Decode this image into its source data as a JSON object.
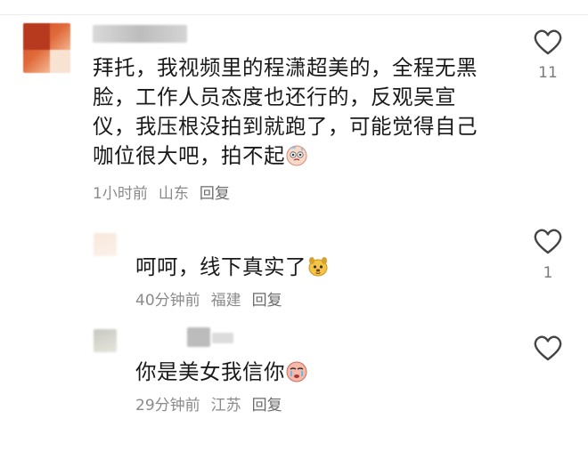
{
  "comments": [
    {
      "text": "拜托，我视频里的程潇超美的，全程无黑脸，工作人员态度也还行的，反观吴宣仪，我压根没拍到就跑了，可能觉得自己咖位很大吧，拍不起",
      "time": "1小时前",
      "location": "山东",
      "reply": "回复",
      "likes": "11"
    }
  ],
  "replies": [
    {
      "text": "呵呵，线下真实了",
      "time": "40分钟前",
      "location": "福建",
      "reply": "回复",
      "likes": "1"
    },
    {
      "text": "你是美女我信你",
      "time": "29分钟前",
      "location": "江苏",
      "reply": "回复",
      "likes": ""
    }
  ],
  "colors": {
    "text": "#1a1a1a",
    "meta": "#8a8a8a",
    "heart_stroke": "#444444"
  },
  "icons": {
    "like": "heart-outline-icon",
    "emoji1": "sweat-face-emoji",
    "emoji2": "dog-face-emoji",
    "emoji3": "crying-face-emoji"
  }
}
